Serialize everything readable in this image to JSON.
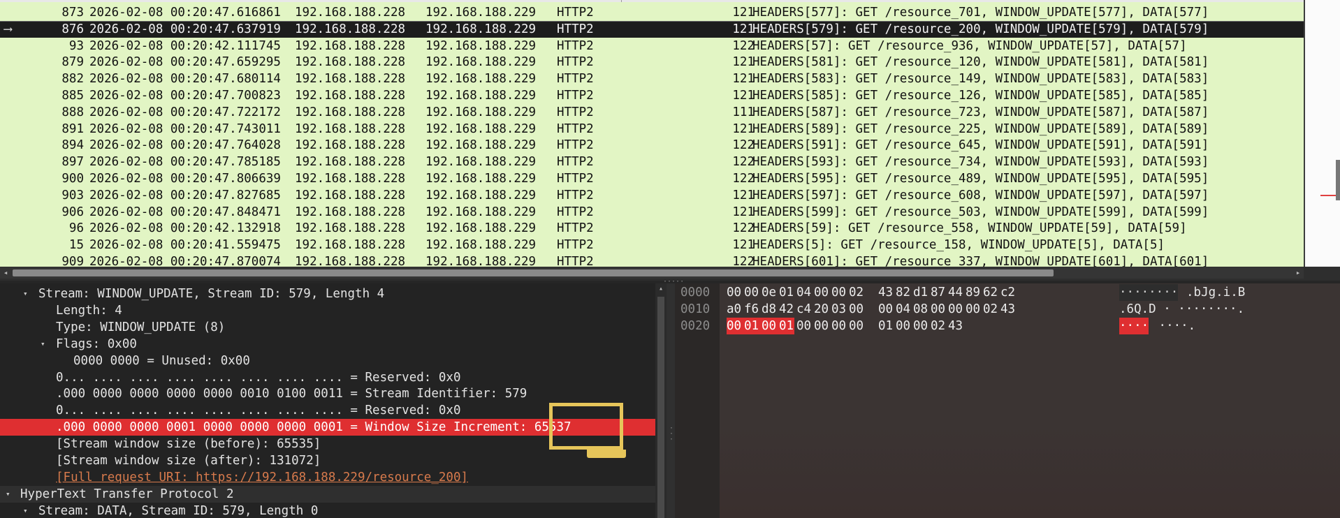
{
  "packet_list": {
    "rows": [
      {
        "no": "873",
        "time": "2026-02-08 00:20:47.616861",
        "src": "192.168.188.228",
        "dst": "192.168.188.229",
        "proto": "HTTP2",
        "len": "121",
        "info": "HEADERS[577]: GET /resource_701, WINDOW_UPDATE[577], DATA[577]",
        "selected": false
      },
      {
        "no": "876",
        "time": "2026-02-08 00:20:47.637919",
        "src": "192.168.188.228",
        "dst": "192.168.188.229",
        "proto": "HTTP2",
        "len": "121",
        "info": "HEADERS[579]: GET /resource_200, WINDOW_UPDATE[579], DATA[579]",
        "selected": true
      },
      {
        "no": "93",
        "time": "2026-02-08 00:20:42.111745",
        "src": "192.168.188.228",
        "dst": "192.168.188.229",
        "proto": "HTTP2",
        "len": "122",
        "info": "HEADERS[57]: GET /resource_936, WINDOW_UPDATE[57], DATA[57]",
        "selected": false
      },
      {
        "no": "879",
        "time": "2026-02-08 00:20:47.659295",
        "src": "192.168.188.228",
        "dst": "192.168.188.229",
        "proto": "HTTP2",
        "len": "121",
        "info": "HEADERS[581]: GET /resource_120, WINDOW_UPDATE[581], DATA[581]",
        "selected": false
      },
      {
        "no": "882",
        "time": "2026-02-08 00:20:47.680114",
        "src": "192.168.188.228",
        "dst": "192.168.188.229",
        "proto": "HTTP2",
        "len": "121",
        "info": "HEADERS[583]: GET /resource_149, WINDOW_UPDATE[583], DATA[583]",
        "selected": false
      },
      {
        "no": "885",
        "time": "2026-02-08 00:20:47.700823",
        "src": "192.168.188.228",
        "dst": "192.168.188.229",
        "proto": "HTTP2",
        "len": "121",
        "info": "HEADERS[585]: GET /resource_126, WINDOW_UPDATE[585], DATA[585]",
        "selected": false
      },
      {
        "no": "888",
        "time": "2026-02-08 00:20:47.722172",
        "src": "192.168.188.228",
        "dst": "192.168.188.229",
        "proto": "HTTP2",
        "len": "111",
        "info": "HEADERS[587]: GET /resource_723, WINDOW_UPDATE[587], DATA[587]",
        "selected": false
      },
      {
        "no": "891",
        "time": "2026-02-08 00:20:47.743011",
        "src": "192.168.188.228",
        "dst": "192.168.188.229",
        "proto": "HTTP2",
        "len": "121",
        "info": "HEADERS[589]: GET /resource_225, WINDOW_UPDATE[589], DATA[589]",
        "selected": false
      },
      {
        "no": "894",
        "time": "2026-02-08 00:20:47.764028",
        "src": "192.168.188.228",
        "dst": "192.168.188.229",
        "proto": "HTTP2",
        "len": "122",
        "info": "HEADERS[591]: GET /resource_645, WINDOW_UPDATE[591], DATA[591]",
        "selected": false
      },
      {
        "no": "897",
        "time": "2026-02-08 00:20:47.785185",
        "src": "192.168.188.228",
        "dst": "192.168.188.229",
        "proto": "HTTP2",
        "len": "122",
        "info": "HEADERS[593]: GET /resource_734, WINDOW_UPDATE[593], DATA[593]",
        "selected": false
      },
      {
        "no": "900",
        "time": "2026-02-08 00:20:47.806639",
        "src": "192.168.188.228",
        "dst": "192.168.188.229",
        "proto": "HTTP2",
        "len": "122",
        "info": "HEADERS[595]: GET /resource_489, WINDOW_UPDATE[595], DATA[595]",
        "selected": false
      },
      {
        "no": "903",
        "time": "2026-02-08 00:20:47.827685",
        "src": "192.168.188.228",
        "dst": "192.168.188.229",
        "proto": "HTTP2",
        "len": "121",
        "info": "HEADERS[597]: GET /resource_608, WINDOW_UPDATE[597], DATA[597]",
        "selected": false
      },
      {
        "no": "906",
        "time": "2026-02-08 00:20:47.848471",
        "src": "192.168.188.228",
        "dst": "192.168.188.229",
        "proto": "HTTP2",
        "len": "121",
        "info": "HEADERS[599]: GET /resource_503, WINDOW_UPDATE[599], DATA[599]",
        "selected": false
      },
      {
        "no": "96",
        "time": "2026-02-08 00:20:42.132918",
        "src": "192.168.188.228",
        "dst": "192.168.188.229",
        "proto": "HTTP2",
        "len": "122",
        "info": "HEADERS[59]: GET /resource_558, WINDOW_UPDATE[59], DATA[59]",
        "selected": false
      },
      {
        "no": "15",
        "time": "2026-02-08 00:20:41.559475",
        "src": "192.168.188.228",
        "dst": "192.168.188.229",
        "proto": "HTTP2",
        "len": "121",
        "info": "HEADERS[5]: GET /resource_158, WINDOW_UPDATE[5], DATA[5]",
        "selected": false
      },
      {
        "no": "909",
        "time": "2026-02-08 00:20:47.870074",
        "src": "192.168.188.228",
        "dst": "192.168.188.229",
        "proto": "HTTP2",
        "len": "122",
        "info": "HEADERS[601]: GET /resource_337, WINDOW_UPDATE[601], DATA[601]",
        "selected": false
      }
    ],
    "selected_marker_icon": "related-packet-arrow-icon",
    "row_color": "#e2f5c4",
    "selected_color": "#1d1d1d"
  },
  "details": {
    "rows": [
      {
        "indent": 1,
        "arrow": "expanded",
        "text": "Stream: WINDOW_UPDATE, Stream ID: 579, Length 4",
        "style": "normal"
      },
      {
        "indent": 2,
        "arrow": "none",
        "text": "Length: 4",
        "style": "normal"
      },
      {
        "indent": 2,
        "arrow": "none",
        "text": "Type: WINDOW_UPDATE (8)",
        "style": "normal"
      },
      {
        "indent": 2,
        "arrow": "expanded",
        "text": "Flags: 0x00",
        "style": "normal"
      },
      {
        "indent": 3,
        "arrow": "none",
        "text": "0000 0000 = Unused: 0x00",
        "style": "normal"
      },
      {
        "indent": 2,
        "arrow": "none",
        "text": "0... .... .... .... .... .... .... .... = Reserved: 0x0",
        "style": "normal"
      },
      {
        "indent": 2,
        "arrow": "none",
        "text": ".000 0000 0000 0000 0000 0010 0100 0011 = Stream Identifier: 579",
        "style": "normal"
      },
      {
        "indent": 2,
        "arrow": "none",
        "text": "0... .... .... .... .... .... .... .... = Reserved: 0x0",
        "style": "normal"
      },
      {
        "indent": 2,
        "arrow": "none",
        "text": ".000 0000 0000 0001 0000 0000 0000 0001 = Window Size Increment: 65537",
        "style": "highlight"
      },
      {
        "indent": 2,
        "arrow": "none",
        "text": "[Stream window size (before): 65535]",
        "style": "normal"
      },
      {
        "indent": 2,
        "arrow": "none",
        "text": "[Stream window size (after): 131072]",
        "style": "normal"
      },
      {
        "indent": 2,
        "arrow": "none",
        "text": "[Full request URI: https://192.168.188.229/resource_200]",
        "style": "link"
      },
      {
        "indent": 0,
        "arrow": "expanded",
        "text": "HyperText Transfer Protocol 2",
        "style": "section"
      },
      {
        "indent": 1,
        "arrow": "expanded",
        "text": "Stream: DATA, Stream ID: 579, Length 0",
        "style": "normal"
      }
    ],
    "highlight_color": "#df2f31",
    "annotation_icon": "monitor-annotation-icon",
    "annotation_color": "#e6c55a"
  },
  "bytes": {
    "rows": [
      {
        "offset": "0000",
        "hex": [
          "00",
          "00",
          "0e",
          "01",
          "04",
          "00",
          "00",
          "02",
          "43",
          "82",
          "d1",
          "87",
          "44",
          "89",
          "62",
          "c2"
        ],
        "hl_count": 0,
        "ascii_dim": "········",
        "ascii": ".bJg.i.B",
        "ascii_hl": ""
      },
      {
        "offset": "0010",
        "hex": [
          "a0",
          "f6",
          "d8",
          "42",
          "c4",
          "20",
          "03",
          "00",
          "00",
          "04",
          "08",
          "00",
          "00",
          "00",
          "02",
          "43"
        ],
        "hl_count": 0,
        "ascii_dim": "",
        "ascii": ".6Q.D · ········.",
        "ascii_hl": ""
      },
      {
        "offset": "0020",
        "hex": [
          "00",
          "01",
          "00",
          "01",
          "00",
          "00",
          "00",
          "00",
          "01",
          "00",
          "00",
          "02",
          "43"
        ],
        "hl_count": 4,
        "ascii_dim": "",
        "ascii": "···· ····.",
        "ascii_hl": "····"
      }
    ]
  }
}
